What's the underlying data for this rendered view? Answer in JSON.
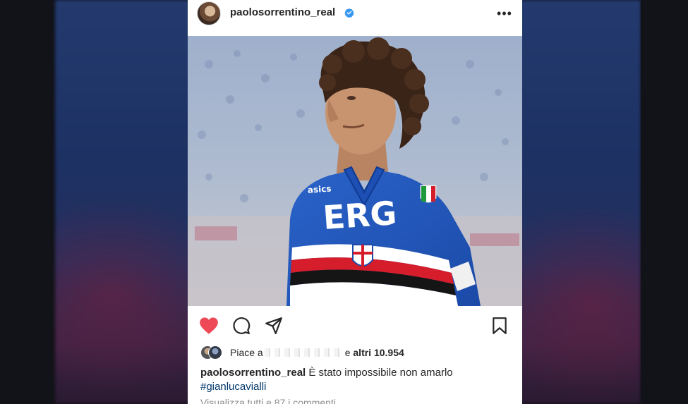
{
  "post": {
    "username": "paolosorrentino_real",
    "verified": true,
    "more_label": "•••",
    "photo": {
      "jersey_sponsor": "ERG",
      "jersey_brand": "asics"
    },
    "actions": {
      "like_icon": "heart-filled-icon",
      "comment_icon": "comment-icon",
      "share_icon": "send-icon",
      "save_icon": "bookmark-icon",
      "like_color": "#ed4956"
    },
    "likes": {
      "prefix": "Piace a",
      "suffix_and": "e",
      "others_count": "altri 10.954"
    },
    "caption": {
      "username": "paolosorrentino_real",
      "text": "È stato impossibile non amarlo",
      "hashtag": "#gianlucavialli"
    },
    "comments_link": "Visualizza tutti e 87 i commenti"
  }
}
